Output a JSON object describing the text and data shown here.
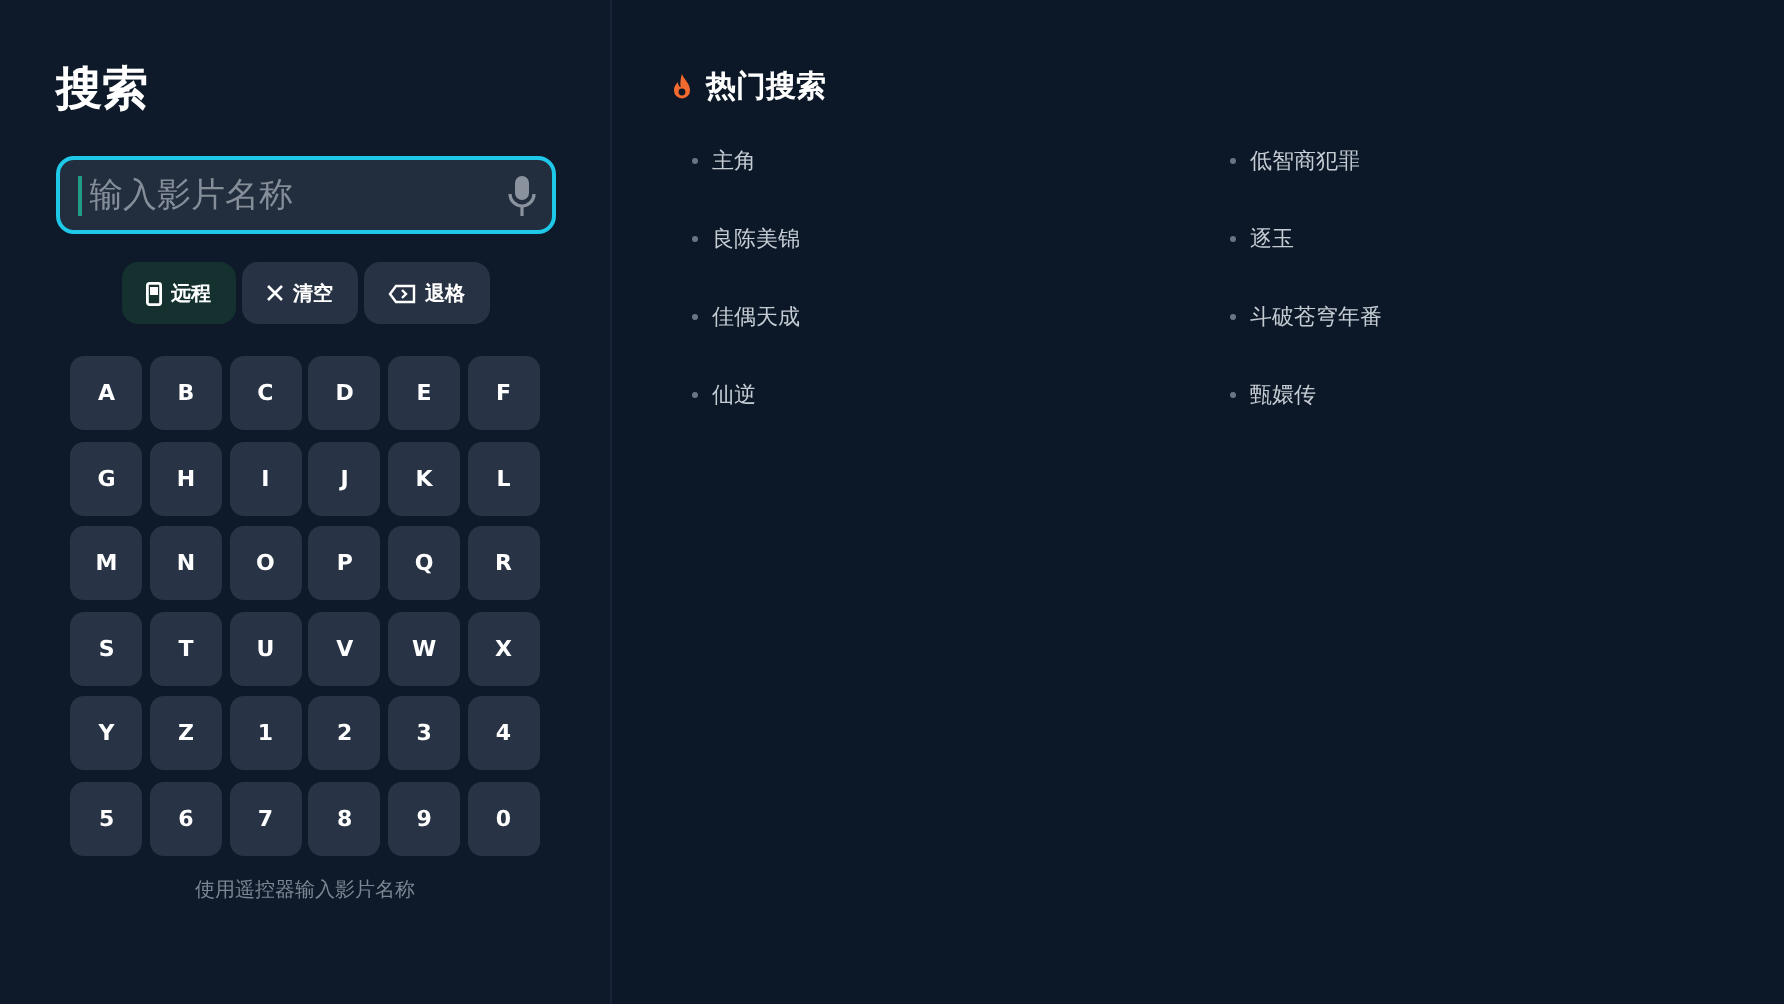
{
  "title": "搜索",
  "search": {
    "placeholder": "输入影片名称",
    "focused": true
  },
  "actions": [
    {
      "label": "远程",
      "kind": "remote",
      "selected": true
    },
    {
      "label": "清空",
      "kind": "clear",
      "selected": false
    },
    {
      "label": "退格",
      "kind": "backspace",
      "selected": false
    }
  ],
  "keys": [
    "A",
    "B",
    "C",
    "D",
    "E",
    "F",
    "G",
    "H",
    "I",
    "J",
    "K",
    "L",
    "M",
    "N",
    "O",
    "P",
    "Q",
    "R",
    "S",
    "T",
    "U",
    "V",
    "W",
    "X",
    "Y",
    "Z",
    "1",
    "2",
    "3",
    "4",
    "5",
    "6",
    "7",
    "8",
    "9",
    "0"
  ],
  "hint": "使用遥控器输入影片名称",
  "hot": {
    "title": "热门搜索",
    "items": [
      "主角",
      "低智商犯罪",
      "良陈美锦",
      "逐玉",
      "佳偶天成",
      "斗破苍穹年番",
      "仙逆",
      "甄嬛传"
    ]
  }
}
